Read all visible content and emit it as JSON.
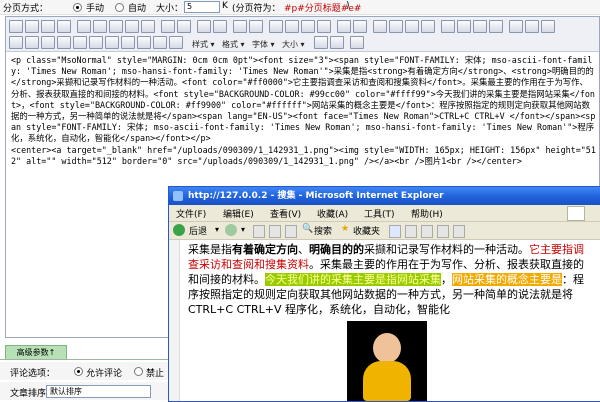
{
  "pager": {
    "label": "分页方式：",
    "manual": "手动",
    "auto": "自动",
    "size_label": "大小：",
    "size_value": "5",
    "size_unit": "K",
    "symbol_label": "(分页符为：",
    "symbol_value": "#p#分页标题#e#",
    "symbol_close": ")"
  },
  "toolbar": {
    "style_label": "样式",
    "format_label": "格式",
    "font_label": "字体",
    "size_label": "大小"
  },
  "source": {
    "text": "<p class=\"MsoNormal\" style=\"MARGIN: 0cm 0cm 0pt\"><font size=\"3\"><span style=\"FONT-FAMILY: 宋体; mso-ascii-font-family: 'Times New Roman'; mso-hansi-font-family: 'Times New Roman'\">采集是指<strong>有着确定方向</strong>、<strong>明确目的的</strong>采撷和记录写作材料的一种活动。<font color=\"#ff0000\">它主要指调查采访和查阅和搜集资料</font>。采集最主要的作用在于为写作、分析、报表获取直接的和间接的材料。<font style=\"BACKGROUND-COLOR: #99cc00\" color=\"#ffff99\">今天我们讲的采集主要是指网站采集</font>，<font style=\"BACKGROUND-COLOR: #ff9900\" color=\"#ffffff\">网站采集的概念主要是</font>：程序按照指定的规则定向获取其他网站数据的一种方式，另一种简单的说法就是将</span><span lang=\"EN-US\"><font face=\"Times New Roman\">CTRL+C CTRL+V </font></span><span style=\"FONT-FAMILY: 宋体; mso-ascii-font-family: 'Times New Roman'; mso-hansi-font-family: 'Times New Roman'\">程序化，系统化，自动化，智能化</span></font></p>\n<center><a target=\"_blank\" href=\"/uploads/090309/1_142931_1.png\"><img style=\"WIDTH: 165px; HEIGHT: 156px\" height=\"512\" alt=\"\" width=\"512\" border=\"0\" src=\"/uploads/090309/1_142931_1.png\" /></a><br />图片1<br /></center>"
  },
  "ie": {
    "title": "http://127.0.0.2 - 搜集 - Microsoft Internet Explorer",
    "menu": [
      "文件(F)",
      "编辑(E)",
      "查看(V)",
      "收藏(A)",
      "工具(T)",
      "帮助(H)"
    ],
    "back_label": "后退",
    "search_label": "搜索",
    "favorites_label": "收藏夹",
    "content": {
      "p1": "采集是指",
      "b1": "有着确定方向",
      "sep": "、",
      "b2": "明确目的的",
      "p2": "采撷和记录写作材料的一种活动。",
      "red": "它主要指调查采访和查阅和搜集资料",
      "p3": "。采集最主要的作用在于为写作、分析、报表获取直接的和间接的材料。",
      "hl1": "今天我们讲的采集主要是指网站采集",
      "comma": "，",
      "hl2": "网站采集的概念主要是",
      "p4": "：程序按照指定的规则定向获取其他网站数据的一种方式，另一种简单的说法就是将CTRL+C CTRL+V 程序化，系统化，自动化，智能化"
    }
  },
  "advanced": {
    "tab_label": "高级参数↑",
    "comment_label": "评论选项：",
    "comment_allow": "允许评论",
    "comment_deny": "禁止",
    "sort_label": "文章排序：",
    "sort_value": "默认排序"
  }
}
